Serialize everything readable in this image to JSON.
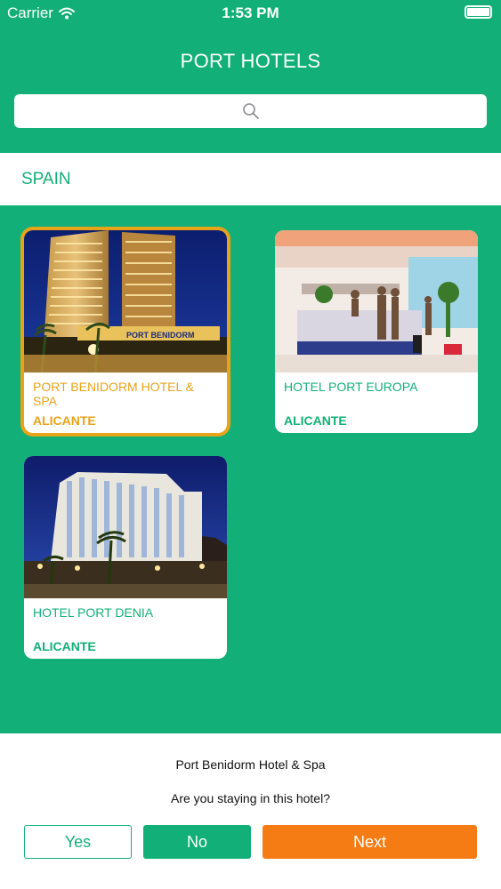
{
  "status_bar": {
    "carrier": "Carrier",
    "time": "1:53 PM"
  },
  "header": {
    "title": "PORT HOTELS",
    "search_placeholder": ""
  },
  "section": {
    "title": "SPAIN"
  },
  "hotels": [
    {
      "name": "PORT BENIDORM HOTEL & SPA",
      "city": "ALICANTE",
      "selected": true,
      "sign_text": "PORT BENIDORM"
    },
    {
      "name": "HOTEL PORT EUROPA",
      "city": "ALICANTE",
      "selected": false
    },
    {
      "name": "HOTEL PORT DENIA",
      "city": "ALICANTE",
      "selected": false
    }
  ],
  "prompt": {
    "hotel_name": "Port Benidorm Hotel & Spa",
    "question": "Are you staying in this hotel?",
    "yes_label": "Yes",
    "no_label": "No",
    "next_label": "Next"
  },
  "colors": {
    "primary": "#12b078",
    "selected": "#e8a319",
    "next": "#f57c14"
  }
}
